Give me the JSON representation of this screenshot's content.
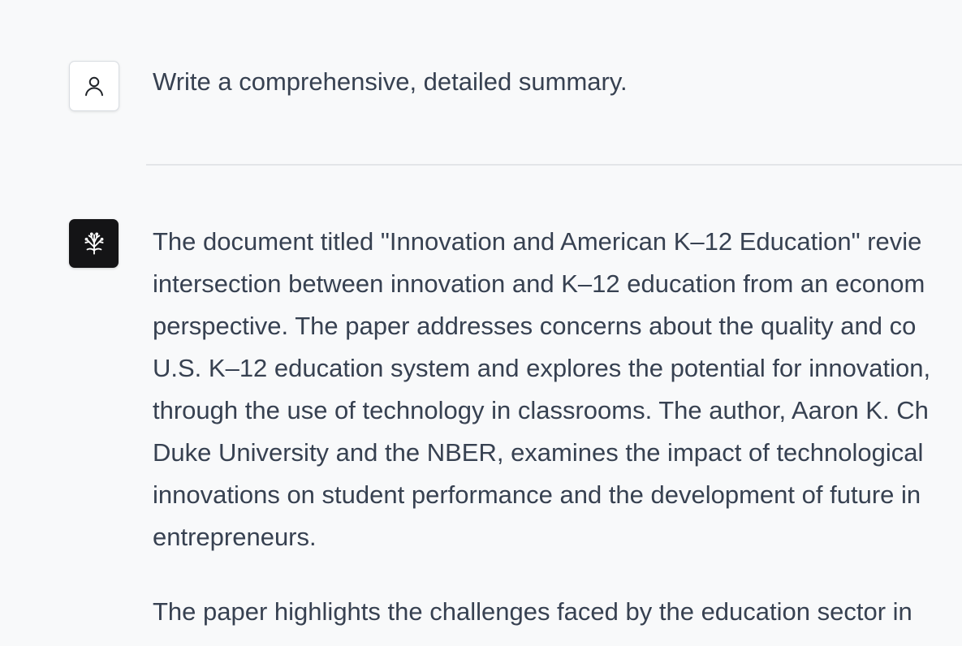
{
  "conversation": {
    "user_message": "Write a comprehensive, detailed summary.",
    "user_avatar_icon": "person-icon",
    "assistant_avatar_icon": "coral-logo-icon",
    "response": {
      "paragraph1_lines": [
        "The document titled \"Innovation and American K–12 Education\" revie",
        "intersection between innovation and K–12 education from an econom",
        "perspective. The paper addresses concerns about the quality and co",
        "U.S. K–12 education system and explores the potential for innovation,",
        "through the use of technology in classrooms. The author, Aaron K. Ch",
        "Duke University and the NBER, examines the impact of technological",
        "innovations on student performance and the development of future in",
        "entrepreneurs."
      ],
      "paragraph2_lines": [
        "The paper highlights the challenges faced by the education sector in"
      ]
    }
  },
  "colors": {
    "background": "#f8f9fa",
    "text": "#374151",
    "assistant_avatar_bg": "#141416",
    "divider": "#e3e5e8"
  }
}
